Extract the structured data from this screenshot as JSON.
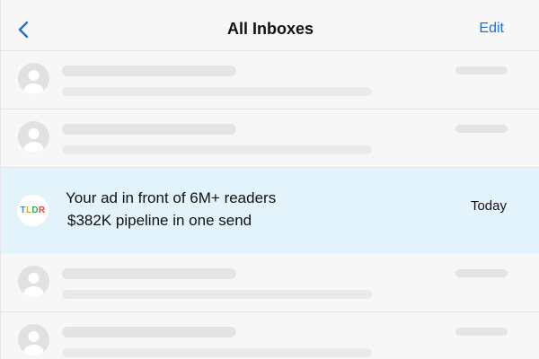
{
  "header": {
    "title": "All Inboxes",
    "edit_label": "Edit",
    "back_icon": "chevron-left-icon"
  },
  "colors": {
    "accent": "#1f6fd1",
    "featured_bg": "#e3f3fb",
    "placeholder": "#e4e4e7"
  },
  "featured_email": {
    "sender_logo_letters": [
      "T",
      "L",
      "D",
      "R"
    ],
    "sender_logo_colors": [
      "#3a8fd6",
      "#e0a02a",
      "#34a853",
      "#e64a3c"
    ],
    "subject": "Your ad in front of 6M+ readers",
    "preview": "$382K pipeline in one send",
    "time": "Today"
  }
}
